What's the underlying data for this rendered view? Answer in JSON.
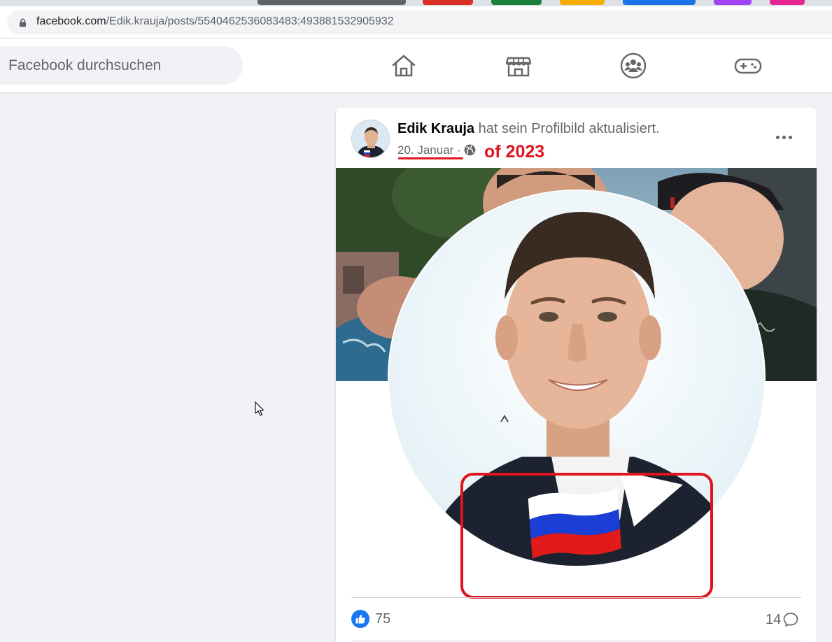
{
  "browser": {
    "url_host": "facebook.com",
    "url_path": "/Edik.krauja/posts/5540462536083483:493881532905932"
  },
  "header": {
    "search_placeholder": "Facebook durchsuchen",
    "nav_icons": [
      "home-icon",
      "marketplace-icon",
      "groups-icon",
      "gaming-icon"
    ]
  },
  "post": {
    "author": "Edik Krauja",
    "action": "hat sein Profilbild aktualisiert.",
    "date": "20. Januar",
    "separator": "·",
    "year_annotation": "of 2023",
    "likes": "75",
    "comments": "14"
  },
  "colors": {
    "annotation_red": "#e0141e",
    "facebook_blue": "#1877f2"
  }
}
